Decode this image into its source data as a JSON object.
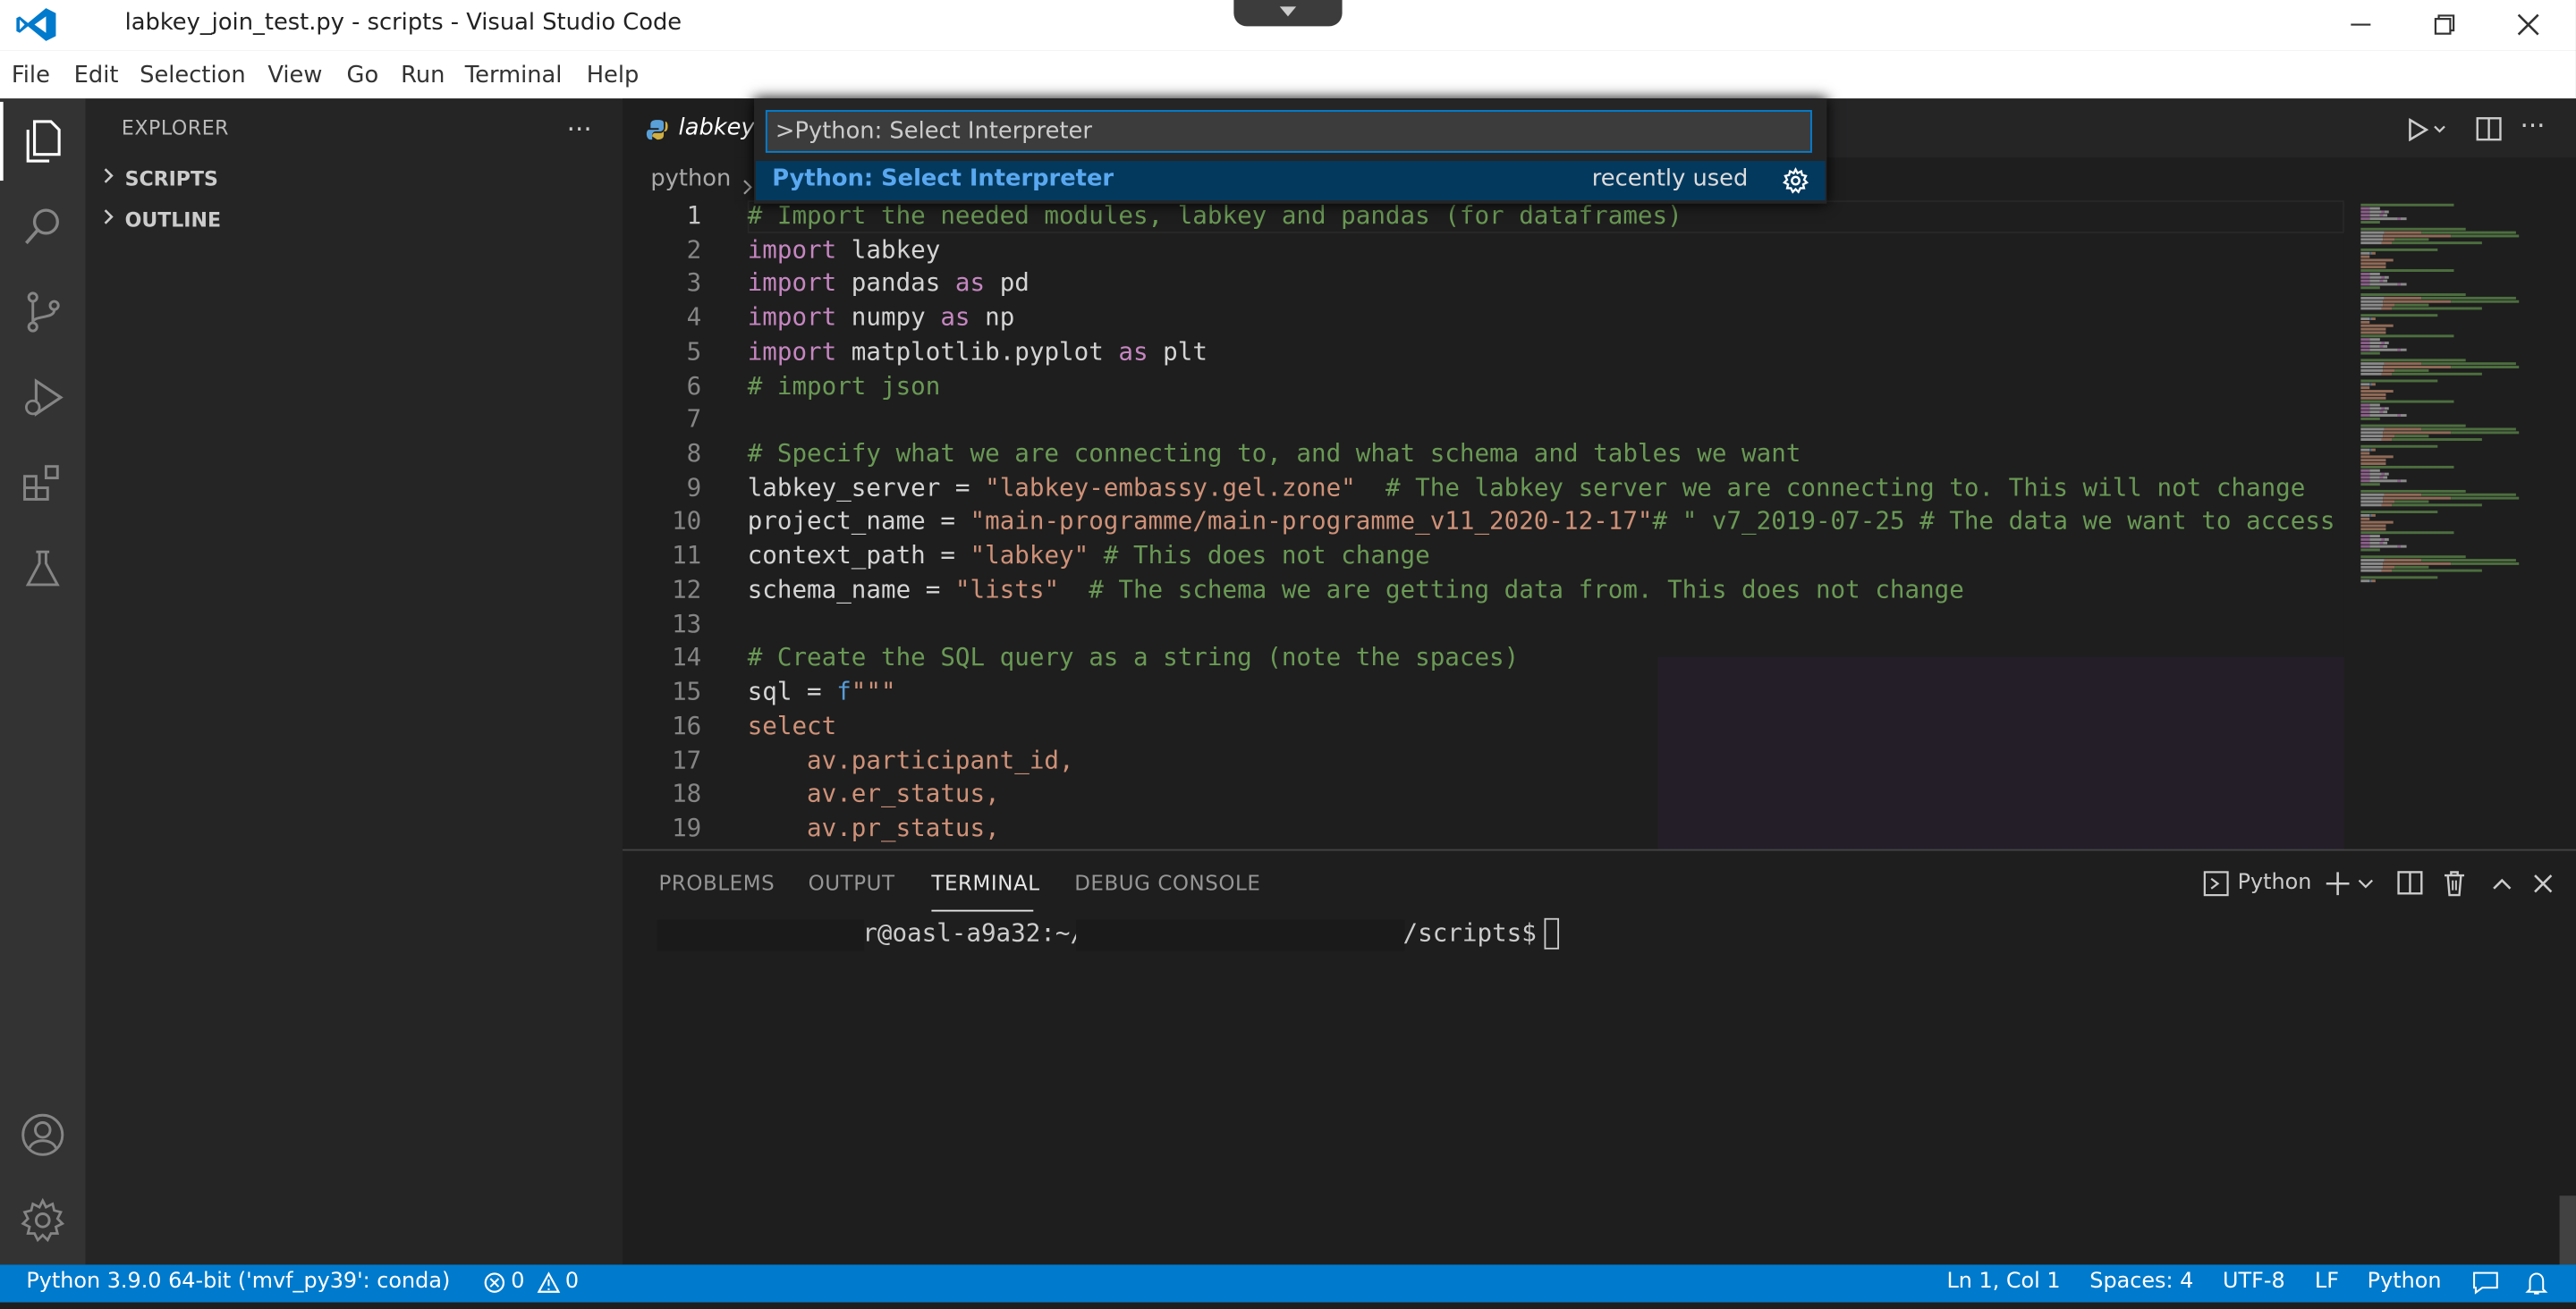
{
  "window": {
    "title": "labkey_join_test.py - scripts - Visual Studio Code",
    "controls": [
      "minimize-icon",
      "restore-icon",
      "close-icon"
    ]
  },
  "menu": [
    "File",
    "Edit",
    "Selection",
    "View",
    "Go",
    "Run",
    "Terminal",
    "Help"
  ],
  "activity_bar": {
    "items": [
      "explorer-icon",
      "search-icon",
      "source-control-icon",
      "run-debug-icon",
      "extensions-icon",
      "testing-icon"
    ],
    "bottom": [
      "account-icon",
      "settings-gear-icon"
    ]
  },
  "sidebar": {
    "title": "EXPLORER",
    "sections": [
      "SCRIPTS",
      "OUTLINE"
    ]
  },
  "editor": {
    "tab_label": "labkey",
    "breadcrumb": "python",
    "lines": [
      {
        "n": "1",
        "parts": [
          [
            "c-com",
            "# Import the needed modules, labkey and pandas (for dataframes)"
          ]
        ]
      },
      {
        "n": "2",
        "parts": [
          [
            "c-kw",
            "import"
          ],
          [
            "c-id",
            " labkey"
          ]
        ]
      },
      {
        "n": "3",
        "parts": [
          [
            "c-kw",
            "import"
          ],
          [
            "c-id",
            " pandas "
          ],
          [
            "c-kw",
            "as"
          ],
          [
            "c-id",
            " pd"
          ]
        ]
      },
      {
        "n": "4",
        "parts": [
          [
            "c-kw",
            "import"
          ],
          [
            "c-id",
            " numpy "
          ],
          [
            "c-kw",
            "as"
          ],
          [
            "c-id",
            " np"
          ]
        ]
      },
      {
        "n": "5",
        "parts": [
          [
            "c-kw",
            "import"
          ],
          [
            "c-id",
            " matplotlib.pyplot "
          ],
          [
            "c-kw",
            "as"
          ],
          [
            "c-id",
            " plt"
          ]
        ]
      },
      {
        "n": "6",
        "parts": [
          [
            "c-com",
            "# import json"
          ]
        ]
      },
      {
        "n": "7",
        "parts": []
      },
      {
        "n": "8",
        "parts": [
          [
            "c-com",
            "# Specify what we are connecting to, and what schema and tables we want"
          ]
        ]
      },
      {
        "n": "9",
        "parts": [
          [
            "c-id",
            "labkey_server = "
          ],
          [
            "c-str",
            "\"labkey-embassy.gel.zone\""
          ],
          [
            "c-com",
            "  # The labkey server we are connecting to. This will not change"
          ]
        ]
      },
      {
        "n": "10",
        "parts": [
          [
            "c-id",
            "project_name = "
          ],
          [
            "c-str",
            "\"main-programme/main-programme_v11_2020-12-17\""
          ],
          [
            "c-com",
            "# \" v7_2019-07-25 # The data we want to access"
          ]
        ]
      },
      {
        "n": "11",
        "parts": [
          [
            "c-id",
            "context_path = "
          ],
          [
            "c-str",
            "\"labkey\""
          ],
          [
            "c-com",
            " # This does not change"
          ]
        ]
      },
      {
        "n": "12",
        "parts": [
          [
            "c-id",
            "schema_name = "
          ],
          [
            "c-str",
            "\"lists\""
          ],
          [
            "c-com",
            "  # The schema we are getting data from. This does not change"
          ]
        ]
      },
      {
        "n": "13",
        "parts": []
      },
      {
        "n": "14",
        "parts": [
          [
            "c-com",
            "# Create the SQL query as a string (note the spaces)"
          ]
        ]
      },
      {
        "n": "15",
        "parts": [
          [
            "c-id",
            "sql = "
          ],
          [
            "c-pf",
            "f"
          ],
          [
            "c-str",
            "\"\"\""
          ]
        ]
      },
      {
        "n": "16",
        "parts": [
          [
            "c-str",
            "select"
          ]
        ]
      },
      {
        "n": "17",
        "parts": [
          [
            "c-str",
            "    av.participant_id,"
          ]
        ]
      },
      {
        "n": "18",
        "parts": [
          [
            "c-str",
            "    av.er_status,"
          ]
        ]
      },
      {
        "n": "19",
        "parts": [
          [
            "c-str",
            "    av.pr_status,"
          ]
        ]
      }
    ],
    "toolbar": [
      "run-icon",
      "split-editor-icon",
      "more-actions-icon"
    ]
  },
  "palette": {
    "input_value": ">Python: Select Interpreter",
    "item_label": "Python: Select Interpreter",
    "item_hint": "recently used"
  },
  "panel": {
    "tabs": [
      "PROBLEMS",
      "OUTPUT",
      "TERMINAL",
      "DEBUG CONSOLE"
    ],
    "active_tab": "TERMINAL",
    "terminal_name": "Python",
    "prompt_host": "r@oasl-a9a32:~/",
    "prompt_path": "/scripts$"
  },
  "status": {
    "interpreter": "Python 3.9.0 64-bit ('mvf_py39': conda)",
    "errors": "0",
    "warnings": "0",
    "cursor": "Ln 1, Col 1",
    "spaces": "Spaces: 4",
    "encoding": "UTF-8",
    "eol": "LF",
    "language": "Python"
  },
  "colors": {
    "accent": "#007acc",
    "palette_border": "#007fd4",
    "palette_selection": "#04395e"
  }
}
